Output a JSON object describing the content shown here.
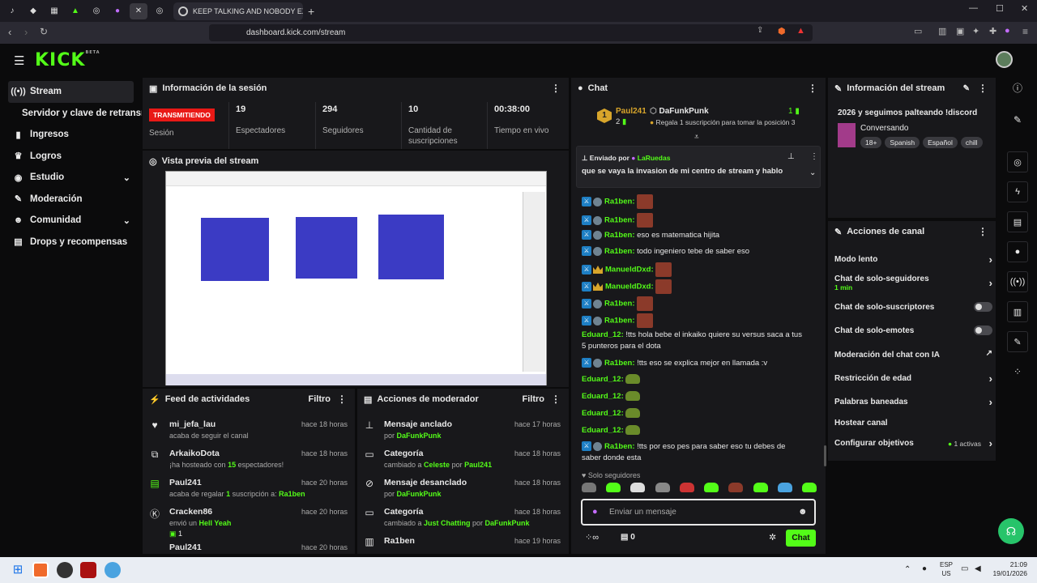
{
  "browser": {
    "active_tab_title": "KEEP TALKING AND NOBODY EXPLO",
    "url": "dashboard.kick.com/stream",
    "window_controls": [
      "—",
      "☐",
      "✕"
    ]
  },
  "logo": {
    "text": "KICK",
    "sup": "BETA"
  },
  "sidebar": {
    "items": [
      {
        "label": "Stream",
        "icon": "broadcast-icon"
      },
      {
        "label": "Servidor y clave de retransmisión",
        "icon": ""
      },
      {
        "label": "Ingresos",
        "icon": "chart-icon"
      },
      {
        "label": "Logros",
        "icon": "trophy-icon"
      },
      {
        "label": "Estudio",
        "icon": "palette-icon"
      },
      {
        "label": "Moderación",
        "icon": "wrench-icon"
      },
      {
        "label": "Comunidad",
        "icon": "people-icon"
      },
      {
        "label": "Drops y recompensas",
        "icon": "gift-icon"
      }
    ]
  },
  "session": {
    "title": "Información de la sesión",
    "badge": "TRANSMITIENDO",
    "badge_label": "Sesión",
    "stats": [
      {
        "value": "19",
        "label": "Espectadores"
      },
      {
        "value": "294",
        "label": "Seguidores"
      },
      {
        "value": "10",
        "label": "Cantidad de suscripciones"
      },
      {
        "value": "00:38:00",
        "label": "Tiempo en vivo"
      }
    ]
  },
  "preview": {
    "title": "Vista previa del stream"
  },
  "feed": {
    "title": "Feed de actividades",
    "filter": "Filtro",
    "items": [
      {
        "name": "mi_jefa_lau",
        "time": "hace 18 horas",
        "sub": "acaba de seguir el canal"
      },
      {
        "name": "ArkaikoDota",
        "time": "hace 18 horas",
        "sub_a": "¡ha hosteado con ",
        "sub_b": "15",
        "sub_c": " espectadores!"
      },
      {
        "name": "Paul241",
        "time": "hace 20 horas",
        "sub_a": "acaba de regalar ",
        "sub_b": "1",
        "sub_c": " suscripción a: ",
        "sub_d": "Ra1ben"
      },
      {
        "name": "Cracken86",
        "time": "hace 20 horas",
        "sub_a": "envió un ",
        "sub_b": "Hell Yeah",
        "extra": "1"
      },
      {
        "name": "Paul241",
        "time": "hace 20 horas"
      }
    ]
  },
  "modactions": {
    "title": "Acciones de moderador",
    "filter": "Filtro",
    "items": [
      {
        "name": "Mensaje anclado",
        "time": "hace 17 horas",
        "sub_a": "por ",
        "sub_b": "DaFunkPunk"
      },
      {
        "name": "Categoría",
        "time": "hace 18 horas",
        "sub_a": "cambiado a ",
        "sub_b": "Celeste",
        "sub_c": " por ",
        "sub_d": "Paul241"
      },
      {
        "name": "Mensaje desanclado",
        "time": "hace 18 horas",
        "sub_a": "por ",
        "sub_b": "DaFunkPunk"
      },
      {
        "name": "Categoría",
        "time": "hace 18 horas",
        "sub_a": "cambiado a ",
        "sub_b": "Just Chatting",
        "sub_c": " por ",
        "sub_d": "DaFunkPunk"
      },
      {
        "name": "Ra1ben",
        "time": "hace 19 horas"
      }
    ]
  },
  "chat": {
    "title": "Chat",
    "top_user": "Paul241",
    "top_count": "2",
    "top_rank": "1",
    "top_streamer": "DaFunkPunk",
    "top_streamer_count": "1",
    "top_cta": "Regala 1 suscripción para tomar la posición 3",
    "pinned_by_label": "Enviado por",
    "pinned_by": "LaRuedas",
    "pinned_text": "que se vaya la invasion de mi centro de stream y hablo",
    "messages": [
      {
        "user": "Ra1ben:",
        "text": "",
        "emote": true,
        "mod": true
      },
      {
        "user": "Ra1ben:",
        "text": "",
        "emote": true,
        "mod": true
      },
      {
        "user": "Ra1ben:",
        "text": "eso es matematica hijita",
        "mod": true
      },
      {
        "user": "Ra1ben:",
        "text": "todo ingeniero tebe de saber eso",
        "mod": true
      },
      {
        "user": "ManueldDxd:",
        "text": "",
        "emote": true,
        "crown": true
      },
      {
        "user": "ManueldDxd:",
        "text": "",
        "emote": true,
        "crown": true
      },
      {
        "user": "Ra1ben:",
        "text": "",
        "emote": true,
        "mod": true
      },
      {
        "user": "Ra1ben:",
        "text": "",
        "emote": true,
        "mod": true
      },
      {
        "user": "Eduard_12:",
        "text": "!tts hola bebe el inkaiko quiere su versus saca a tus 5 punteros para el dota"
      },
      {
        "user": "Ra1ben:",
        "text": "!tts eso se explica mejor en llamada :v",
        "mod": true
      },
      {
        "user": "Eduard_12:",
        "text": "",
        "emote2": true
      },
      {
        "user": "Eduard_12:",
        "text": "",
        "emote2": true
      },
      {
        "user": "Eduard_12:",
        "text": "",
        "emote2": true
      },
      {
        "user": "Eduard_12:",
        "text": "",
        "emote2": true
      },
      {
        "user": "Ra1ben:",
        "text": "!tts por eso pes para saber eso tu debes de saber donde esta",
        "mod": true
      }
    ],
    "followers_only": "Solo seguidores",
    "input_placeholder": "Enviar un mensaje",
    "points": "0",
    "send": "Chat"
  },
  "stream_info": {
    "title": "Información del stream",
    "stream_title": "2026 y seguimos palteando !discord",
    "category": "Conversando",
    "tags": [
      "18+",
      "Spanish",
      "Español",
      "chill"
    ]
  },
  "channel_actions": {
    "title": "Acciones de canal",
    "items": [
      {
        "label": "Modo lento",
        "kind": "chevron"
      },
      {
        "label": "Chat de solo-seguidores",
        "sub": "1 min",
        "kind": "chevron"
      },
      {
        "label": "Chat de solo-suscriptores",
        "kind": "toggle"
      },
      {
        "label": "Chat de solo-emotes",
        "kind": "toggle"
      },
      {
        "label": "Moderación del chat con IA",
        "kind": "external"
      },
      {
        "label": "Restricción de edad",
        "kind": "chevron"
      },
      {
        "label": "Palabras baneadas",
        "kind": "chevron"
      },
      {
        "label": "Hostear canal",
        "kind": "none"
      },
      {
        "label": "Configurar objetivos",
        "status": "1 activas",
        "kind": "chevron"
      }
    ]
  },
  "taskbar": {
    "lang": "ESP",
    "region": "US",
    "time": "21:09",
    "date": "19/01/2026"
  },
  "colors": {
    "accent": "#53fc18",
    "live": "#e91916",
    "panel": "#18181b",
    "bg": "#0b0b0c"
  }
}
